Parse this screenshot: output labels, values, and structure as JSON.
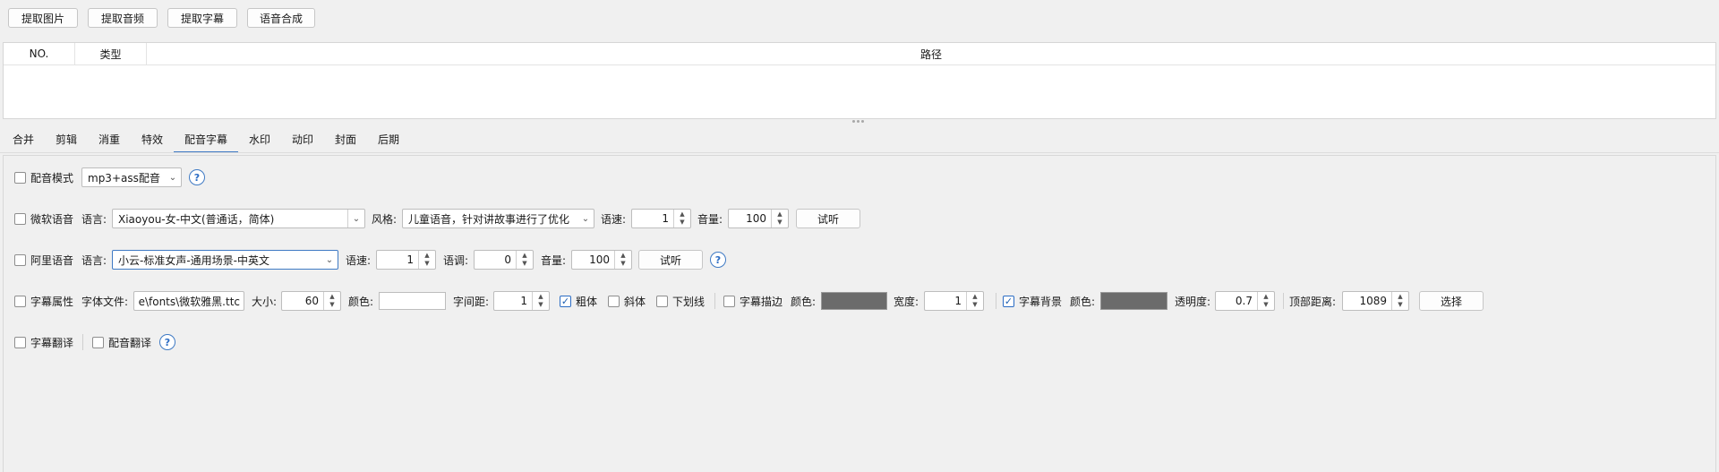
{
  "toolbar": {
    "extract_image": "提取图片",
    "extract_audio": "提取音频",
    "extract_subtitle": "提取字幕",
    "tts": "语音合成"
  },
  "table": {
    "columns": [
      "NO.",
      "类型",
      "路径"
    ],
    "rows": []
  },
  "tabs": [
    "合并",
    "剪辑",
    "消重",
    "特效",
    "配音字幕",
    "水印",
    "动印",
    "封面",
    "后期"
  ],
  "active_tab": "配音字幕",
  "dub_mode": {
    "label": "配音模式",
    "checked": false,
    "value": "mp3+ass配音"
  },
  "ms_voice": {
    "label": "微软语音",
    "checked": false,
    "lang_label": "语言:",
    "lang_value": "Xiaoyou-女-中文(普通话，简体)",
    "style_label": "风格:",
    "style_value": "儿童语音，针对讲故事进行了优化",
    "speed_label": "语速:",
    "speed": "1",
    "volume_label": "音量:",
    "volume": "100",
    "preview": "试听"
  },
  "ali_voice": {
    "label": "阿里语音",
    "checked": false,
    "lang_label": "语言:",
    "lang_value": "小云-标准女声-通用场景-中英文",
    "speed_label": "语速:",
    "speed": "1",
    "pitch_label": "语调:",
    "pitch": "0",
    "volume_label": "音量:",
    "volume": "100",
    "preview": "试听"
  },
  "subtitle": {
    "label": "字幕属性",
    "checked": false,
    "font_label": "字体文件:",
    "font_value": "e\\fonts\\微软雅黑.ttc",
    "size_label": "大小:",
    "size": "60",
    "color_label": "颜色:",
    "color": "#ffffff",
    "spacing_label": "字间距:",
    "spacing": "1",
    "bold_label": "粗体",
    "bold": true,
    "italic_label": "斜体",
    "italic": false,
    "underline_label": "下划线",
    "underline": false,
    "outline_label": "字幕描边",
    "outline": false,
    "outline_color_label": "颜色:",
    "outline_color": "#6b6b6b",
    "width_label": "宽度:",
    "width": "1",
    "bg_label": "字幕背景",
    "bg": true,
    "bg_color_label": "颜色:",
    "bg_color": "#6b6b6b",
    "opacity_label": "透明度:",
    "opacity": "0.7",
    "top_label": "顶部距离:",
    "top": "1089",
    "select": "选择"
  },
  "translate": {
    "subtitle_label": "字幕翻译",
    "subtitle_checked": false,
    "dub_label": "配音翻译",
    "dub_checked": false
  },
  "icons": {
    "help": "question-icon",
    "dropdown": "chevron-down-icon",
    "spin": "spin-arrows-icon",
    "check": "checkmark-icon"
  }
}
